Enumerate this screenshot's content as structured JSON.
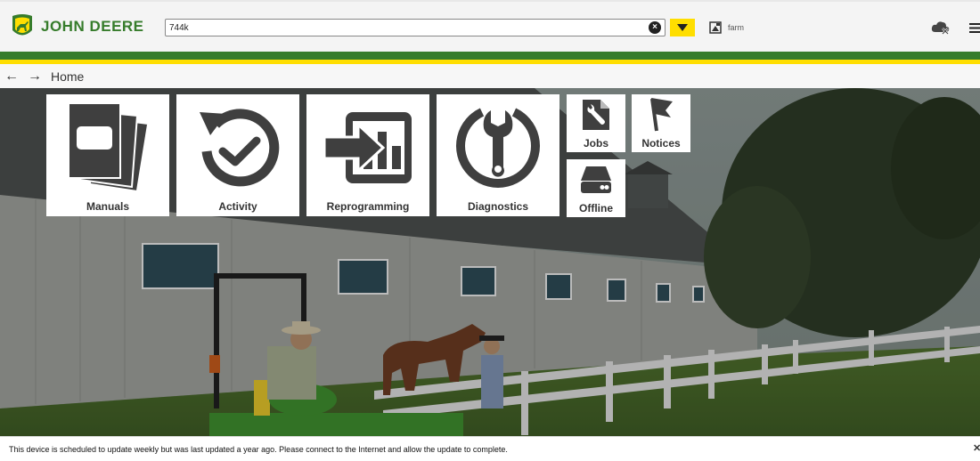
{
  "header": {
    "brand_name": "JOHN DEERE",
    "search_value": "744k",
    "farm_label": "farm",
    "accent_green": "#367c2b",
    "accent_yellow": "#ffde00"
  },
  "nav": {
    "breadcrumb": "Home"
  },
  "tiles": {
    "manuals": "Manuals",
    "activity": "Activity",
    "reprogramming": "Reprogramming",
    "diagnostics": "Diagnostics",
    "jobs": "Jobs",
    "notices": "Notices",
    "offline": "Offline"
  },
  "footer": {
    "message": "This device is scheduled to update weekly but was last updated a year ago. Please connect to the Internet and allow the update to complete.",
    "close_icon": "close-icon"
  }
}
